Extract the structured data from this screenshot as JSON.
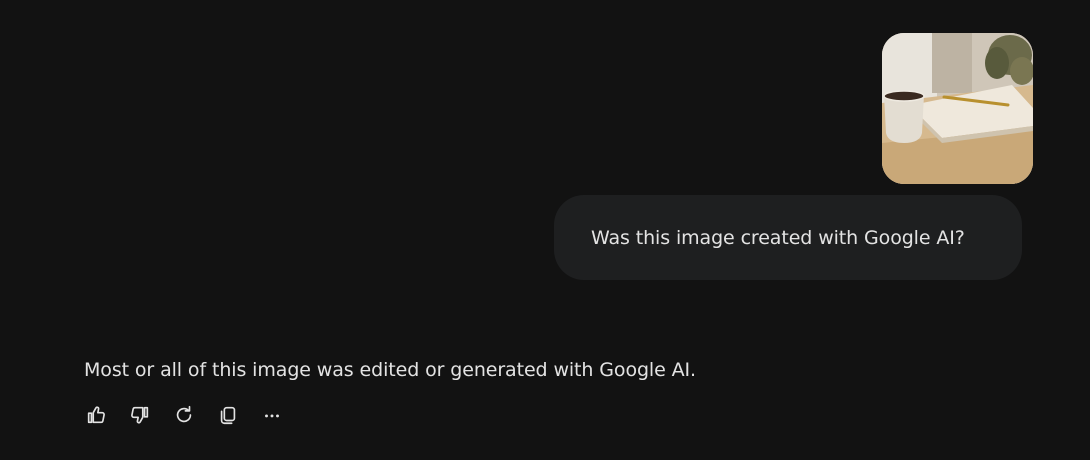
{
  "conversation": {
    "user_message": {
      "image_description_icon": "uploaded-image",
      "text": "Was this image created with Google AI?"
    },
    "model_response": {
      "text": "Most or all of this image was edited or generated with Google AI."
    }
  },
  "response_actions": [
    {
      "icon": "thumbs-up-icon"
    },
    {
      "icon": "thumbs-down-icon"
    },
    {
      "icon": "refresh-icon"
    },
    {
      "icon": "copy-icon"
    },
    {
      "icon": "more-icon"
    }
  ],
  "colors": {
    "background": "#121212",
    "bubble": "#1e1f20",
    "text": "#e3e3e3"
  }
}
